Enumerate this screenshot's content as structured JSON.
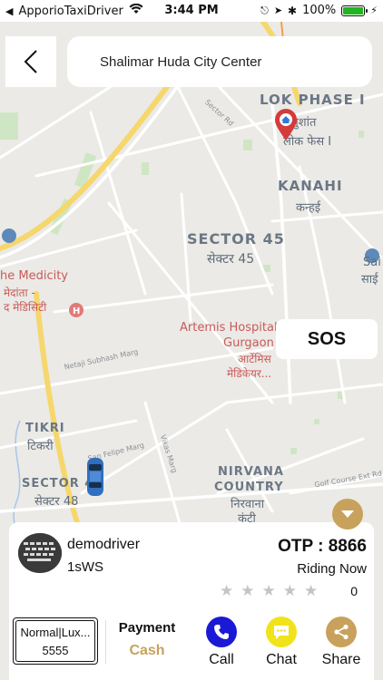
{
  "status_bar": {
    "carrier": "ApporioTaxiDriver",
    "time": "3:44 PM",
    "battery": "100%",
    "battery_level": 1.0
  },
  "header": {
    "back_icon": "chevron-left-icon",
    "destination": "Shalimar Huda City Center"
  },
  "map": {
    "labels": {
      "lok_phase": "LOK PHASE I",
      "lok_hindi": "लोक फेस I",
      "lok_hindi_top": "सुशांत",
      "kanahi": "KANAHI",
      "kanahi_hindi": "कन्हई",
      "sector45": "SECTOR 45",
      "sector45_hindi": "सेक्टर 45",
      "medicity": "he Medicity",
      "medicity_hindi": "मेदांता -",
      "medicity_hindi2": "द मेडिसिटी",
      "artemis": "Artemis Hospital",
      "artemis2": "Gurgaon",
      "artemis_hindi": "आर्टेमिस",
      "artemis_hindi2": "मेडिकेयर...",
      "tikri": "TIKRI",
      "tikri_hindi": "टिकरी",
      "sector48": "SECTOR 48",
      "sector48_hindi": "सेक्टर 48",
      "nirvana": "NIRVANA",
      "nirvana2": "COUNTRY",
      "nirvana_hindi": "निरवाना",
      "nirvana_hindi2": "कंट्री",
      "sai": "Sai",
      "sai_hindi": "साई",
      "road_sector": "Sector Rd",
      "road_netaji": "Netaji Subhash Marg",
      "road_sanfelipe": "San Felipe Marg",
      "road_vikas": "Vikas Marg",
      "road_golf": "Golf Course Ext Rd"
    }
  },
  "sos_label": "SOS",
  "driver": {
    "name": "demodriver",
    "vehicle": "1sWS",
    "otp": "OTP : 8866",
    "status": "Riding Now",
    "rating": "0",
    "stars": 0
  },
  "service": {
    "type": "Normal|Lux...",
    "number": "5555"
  },
  "payment": {
    "label": "Payment",
    "value": "Cash"
  },
  "actions": {
    "call": "Call",
    "chat": "Chat",
    "share": "Share"
  },
  "colors": {
    "accent": "#c8a15c",
    "call": "#1a1ad6",
    "chat": "#f1e31a",
    "share": "#c8a15c",
    "route": "#2f7ad8",
    "pin": "#d43b3b"
  }
}
